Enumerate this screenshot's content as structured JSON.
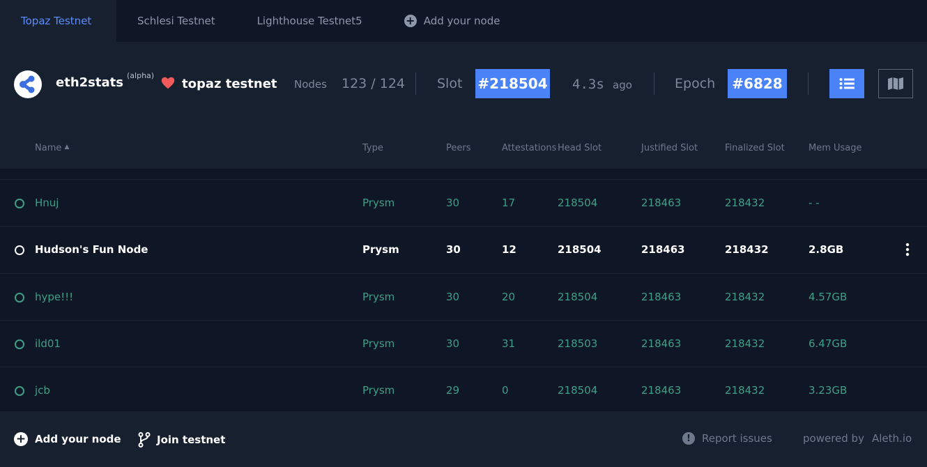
{
  "tabs": [
    {
      "label": "Topaz Testnet",
      "active": true
    },
    {
      "label": "Schlesi Testnet",
      "active": false
    },
    {
      "label": "Lighthouse Testnet5",
      "active": false
    },
    {
      "label": "Add your node",
      "active": false
    }
  ],
  "header": {
    "brand": "eth2stats",
    "alpha": "(alpha)",
    "network": "topaz testnet",
    "nodes_label": "Nodes",
    "nodes_value": "123 / 124",
    "slot_label": "Slot",
    "slot_value": "#218504",
    "ago_value": "4.3s",
    "ago_label": "ago",
    "epoch_label": "Epoch",
    "epoch_value": "#6828"
  },
  "table": {
    "columns": [
      "Name",
      "Type",
      "Peers",
      "Attestations",
      "Head Slot",
      "Justified Slot",
      "Finalized Slot",
      "Mem Usage"
    ],
    "sort_indicator": "▲",
    "rows": [
      {
        "name": "Hnuj",
        "type": "Prysm",
        "peers": "30",
        "attestations": "17",
        "head": "218504",
        "justified": "218463",
        "finalized": "218432",
        "mem": "- -",
        "highlight": false
      },
      {
        "name": "Hudson's Fun Node",
        "type": "Prysm",
        "peers": "30",
        "attestations": "12",
        "head": "218504",
        "justified": "218463",
        "finalized": "218432",
        "mem": "2.8GB",
        "highlight": true
      },
      {
        "name": "hype!!!",
        "type": "Prysm",
        "peers": "30",
        "attestations": "20",
        "head": "218504",
        "justified": "218463",
        "finalized": "218432",
        "mem": "4.57GB",
        "highlight": false
      },
      {
        "name": "ild01",
        "type": "Prysm",
        "peers": "30",
        "attestations": "31",
        "head": "218503",
        "justified": "218463",
        "finalized": "218432",
        "mem": "6.47GB",
        "highlight": false
      },
      {
        "name": "jcb",
        "type": "Prysm",
        "peers": "29",
        "attestations": "0",
        "head": "218504",
        "justified": "218463",
        "finalized": "218432",
        "mem": "3.23GB",
        "highlight": false
      }
    ]
  },
  "footer": {
    "add_node": "Add your node",
    "join_testnet": "Join testnet",
    "report_issues": "Report issues",
    "powered_by": "powered by",
    "powered_by_name": "Aleth.io"
  },
  "colors": {
    "accent": "#4a82f8",
    "heart": "#f05a5a",
    "node_text": "#3f9f86"
  },
  "icons": {
    "logo": "eth2stats-logo-icon",
    "heart": "heart-icon",
    "list_view": "list-icon",
    "map_view": "map-icon",
    "add": "plus-circle-icon",
    "fork": "git-branch-icon",
    "report": "exclamation-circle-icon",
    "row_menu": "kebab-menu-icon"
  }
}
